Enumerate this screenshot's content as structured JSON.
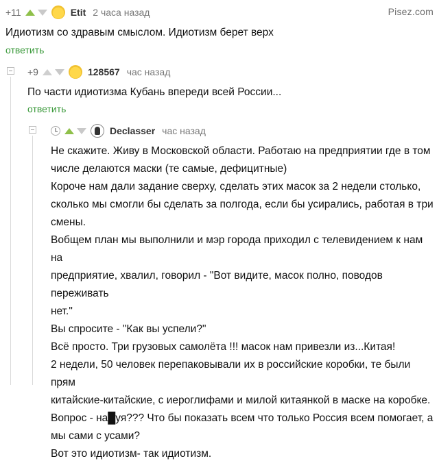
{
  "watermark": "Pisez.com",
  "comments": [
    {
      "score": "+11",
      "user": "Etit",
      "time": "2 часа назад",
      "text": "Идиотизм со здравым смыслом. Идиотизм берет верх",
      "reply": "ответить"
    },
    {
      "score": "+9",
      "user": "128567",
      "time": "час назад",
      "text": "По части идиотизма Кубань впереди всей России...",
      "reply": "ответить"
    },
    {
      "user": "Declasser",
      "time": "час назад",
      "lines": [
        "Не скажите. Живу в Московской области. Работаю на предприятии где в том",
        "числе делаются маски (те самые, дефицитные)",
        "Короче нам дали задание сверху, сделать этих масок за 2 недели столько,",
        "сколько мы смогли бы сделать за полгода, если бы усирались, работая в три",
        "смены.",
        "Вобщем план мы выполнили и мэр города приходил с телевидением к нам на",
        "предприятие, хвалил, говорил - \"Вот видите, масок полно, поводов переживать",
        "нет.\"",
        "Вы спросите - \"Как вы успели?\"",
        "Всё просто. Три грузовых самолёта !!! масок нам привезли из...Китая!",
        "2 недели, 50 человек перепаковывали их в российские коробки, те были прям",
        "китайские-китайские, с иероглифами и милой китаянкой в маске на коробке.",
        "Вопрос - на█уя??? Что бы показать всем что только Россия всем помогает, а",
        "мы сами с усами?",
        "Вот это идиотизм- так идиотизм."
      ]
    }
  ]
}
